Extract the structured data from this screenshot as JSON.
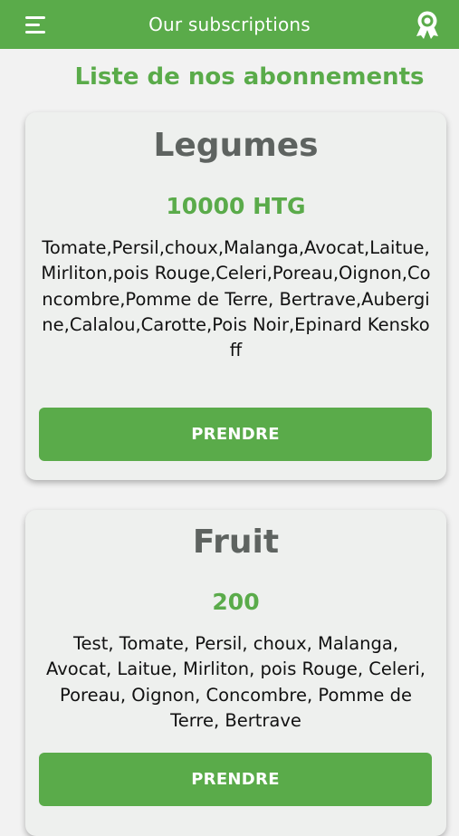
{
  "app_bar": {
    "title": "Our subscriptions",
    "menu_icon": "hamburger-menu-icon",
    "right_icon": "award-ribbon-icon"
  },
  "heading": "Liste de nos abonnements",
  "subscriptions": [
    {
      "name": "Legumes",
      "price": "10000 HTG",
      "description": "Tomate,Persil,choux,Malanga,Avocat,Laitue,Mirliton,pois Rouge,Celeri,Poreau,Oignon,Concombre,Pomme de Terre, Bertrave,Aubergine,Calalou,Carotte,Pois Noir,Epinard Kenskoff",
      "button_label": "PRENDRE"
    },
    {
      "name": "Fruit",
      "price": "200",
      "description": "Test, Tomate, Persil, choux, Malanga, Avocat, Laitue, Mirliton, pois Rouge, Celeri, Poreau, Oignon, Concombre, Pomme de Terre,  Bertrave",
      "button_label": "PRENDRE"
    }
  ],
  "colors": {
    "primary_green": "#5aab4a",
    "card_background": "#eef0ee",
    "title_gray": "#5e6360"
  }
}
